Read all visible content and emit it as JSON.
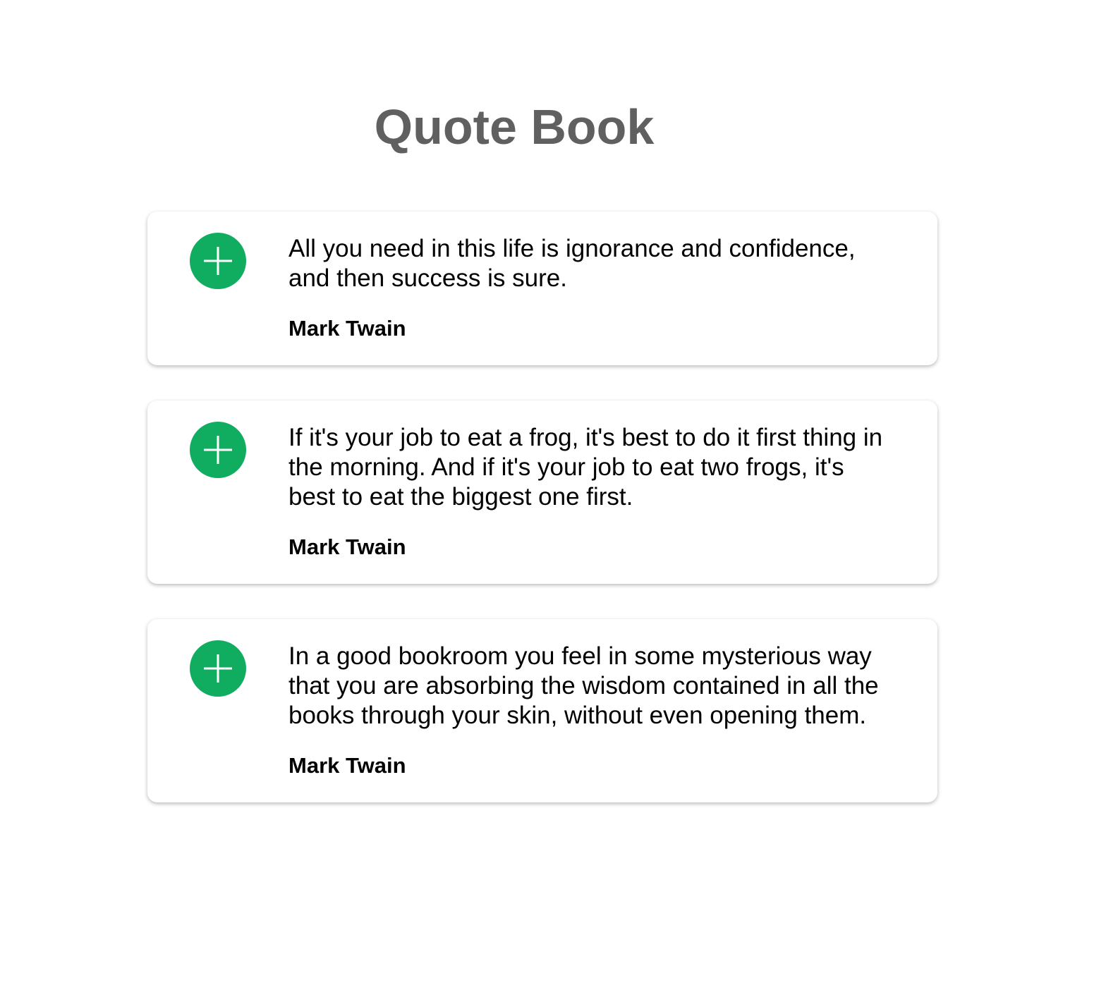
{
  "header": {
    "title": "Quote Book"
  },
  "colors": {
    "accent": "#10ad60",
    "title": "#606060"
  },
  "quotes": [
    {
      "icon": "plus-icon",
      "text": "All you need in this life is ignorance and confidence, and then success is sure.",
      "author": "Mark Twain"
    },
    {
      "icon": "plus-icon",
      "text": "If it's your job to eat a frog, it's best to do it first thing in the morning. And if it's your job to eat two frogs, it's best to eat the biggest one first.",
      "author": "Mark Twain"
    },
    {
      "icon": "plus-icon",
      "text": "In a good bookroom you feel in some mysterious way that you are absorbing the wisdom contained in all the books through your skin, without even opening them.",
      "author": "Mark Twain"
    }
  ]
}
